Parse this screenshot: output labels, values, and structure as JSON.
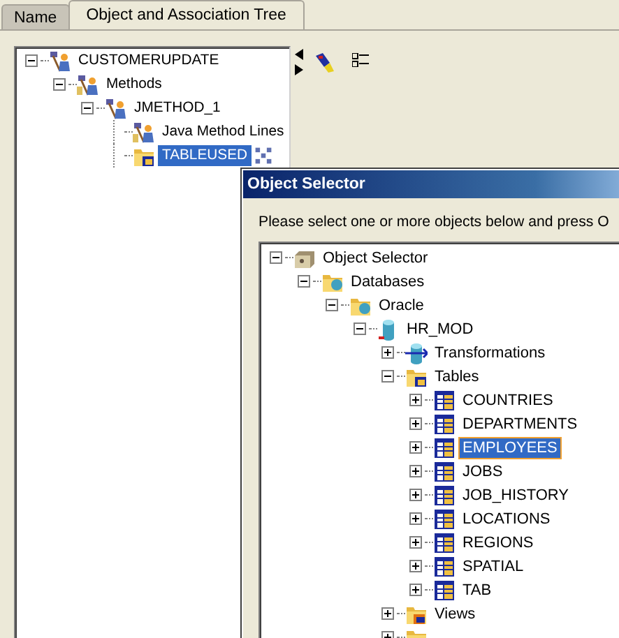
{
  "tabs": [
    {
      "label": "Name",
      "selected": false
    },
    {
      "label": "Object and Association Tree",
      "selected": true
    }
  ],
  "association_tree": [
    {
      "label": "CUSTOMERUPDATE",
      "kind": "component",
      "expanded": true,
      "selected": false,
      "associated": false,
      "children": [
        {
          "label": "Methods",
          "kind": "methods",
          "expanded": true,
          "selected": false,
          "associated": false,
          "children": [
            {
              "label": "JMETHOD_1",
              "kind": "method",
              "expanded": true,
              "selected": false,
              "associated": false,
              "children": [
                {
                  "label": "Java Method Lines",
                  "kind": "methods",
                  "selected": false,
                  "associated": false
                },
                {
                  "label": "TABLEUSED",
                  "kind": "table-folder",
                  "selected": true,
                  "associated": true
                }
              ]
            }
          ]
        }
      ]
    }
  ],
  "object_selector": {
    "title": "Object Selector",
    "prompt": "Please select one or more objects below and press O",
    "tree": [
      {
        "label": "Object Selector",
        "kind": "root",
        "expanded": true,
        "selected": false,
        "children": [
          {
            "label": "Databases",
            "kind": "db-folder",
            "expanded": true,
            "selected": false,
            "children": [
              {
                "label": "Oracle",
                "kind": "db-folder",
                "expanded": true,
                "selected": false,
                "children": [
                  {
                    "label": "HR_MOD",
                    "kind": "database",
                    "expanded": true,
                    "selected": false,
                    "children": [
                      {
                        "label": "Transformations",
                        "kind": "transform",
                        "expanded": false,
                        "selected": false
                      },
                      {
                        "label": "Tables",
                        "kind": "table-folder",
                        "expanded": true,
                        "selected": false,
                        "children": [
                          {
                            "label": "COUNTRIES",
                            "kind": "table",
                            "expanded": false,
                            "selected": false
                          },
                          {
                            "label": "DEPARTMENTS",
                            "kind": "table",
                            "expanded": false,
                            "selected": false
                          },
                          {
                            "label": "EMPLOYEES",
                            "kind": "table",
                            "expanded": false,
                            "selected": true
                          },
                          {
                            "label": "JOBS",
                            "kind": "table",
                            "expanded": false,
                            "selected": false
                          },
                          {
                            "label": "JOB_HISTORY",
                            "kind": "table",
                            "expanded": false,
                            "selected": false
                          },
                          {
                            "label": "LOCATIONS",
                            "kind": "table",
                            "expanded": false,
                            "selected": false
                          },
                          {
                            "label": "REGIONS",
                            "kind": "table",
                            "expanded": false,
                            "selected": false
                          },
                          {
                            "label": "SPATIAL",
                            "kind": "table",
                            "expanded": false,
                            "selected": false
                          },
                          {
                            "label": "TAB",
                            "kind": "table",
                            "expanded": false,
                            "selected": false
                          }
                        ]
                      },
                      {
                        "label": "Views",
                        "kind": "view-folder",
                        "expanded": false,
                        "selected": false
                      },
                      {
                        "kind": "folder",
                        "expanded": false
                      }
                    ]
                  }
                ]
              }
            ]
          }
        ]
      }
    ]
  }
}
